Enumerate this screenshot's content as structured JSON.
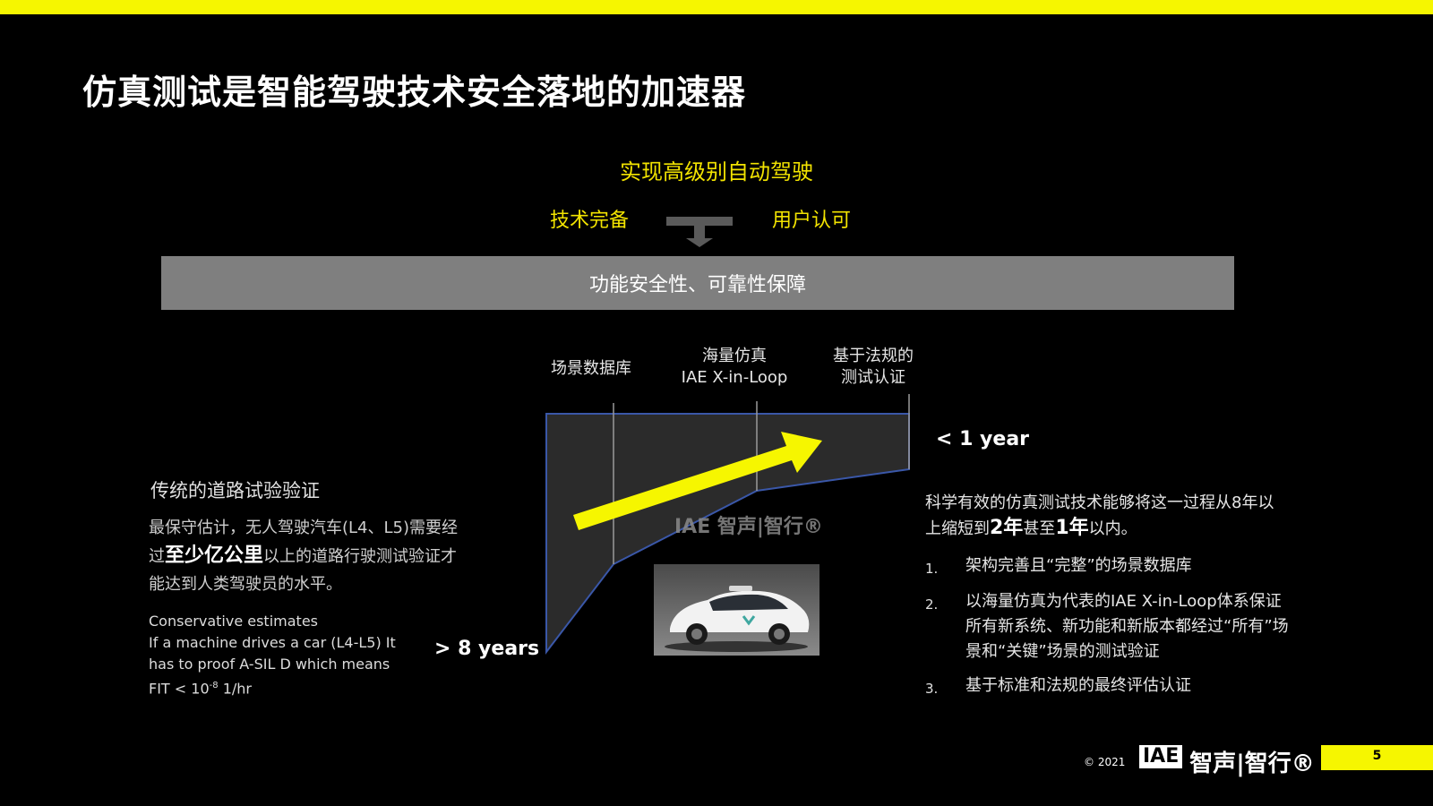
{
  "slide": {
    "title": "仿真测试是智能驾驶技术安全落地的加速器",
    "goal": "实现高级别自动驾驶",
    "pillar_left": "技术完备",
    "pillar_right": "用户认可",
    "safety_band": "功能安全性、可靠性保障",
    "page_number": "5"
  },
  "diagram": {
    "stage1": "场景数据库",
    "stage2_line1": "海量仿真",
    "stage2_line2": "IAE X-in-Loop",
    "stage3_line1": "基于法规的",
    "stage3_line2": "测试认证",
    "lt_year": "< 1 year",
    "gt_years": "> 8 years",
    "watermark": "IAE 智声|智行®"
  },
  "traditional": {
    "title": "传统的道路试验验证",
    "body_1": "最保守估计，无人驾驶汽车(L4、L5)需要经过",
    "body_hl": "至少亿公里",
    "body_2": "以上的道路行驶测试验证才能达到人类驾驶员的水平。",
    "en_1": "Conservative estimates",
    "en_2": "If a machine drives a car (L4-L5) It has to proof A-SIL D which means",
    "en_3_prefix": "FIT < 10",
    "en_3_sup": "-8",
    "en_3_suffix": " 1/hr"
  },
  "right": {
    "intro_1": "科学有效的仿真测试技术能够将这一过程从8年以上缩短到",
    "intro_2y": "2年",
    "intro_mid": "甚至",
    "intro_1y": "1年",
    "intro_end": "以内。",
    "items": [
      {
        "num": "1.",
        "text": "架构完善且“完整”的场景数据库"
      },
      {
        "num": "2.",
        "text": "以海量仿真为代表的IAE X-in-Loop体系保证所有新系统、新功能和新版本都经过“所有”场景和“关键”场景的测试验证"
      },
      {
        "num": "3.",
        "text": "基于标准和法规的最终评估认证"
      }
    ]
  },
  "footer": {
    "copyright": "© 2021",
    "logo_mark": "IAE",
    "logo_text": "智声|智行®"
  },
  "colors": {
    "accent_yellow": "#f6f600",
    "band_gray": "#7f7f7f",
    "funnel_fill": "#2b2b2b",
    "funnel_border": "#3a57a8"
  }
}
